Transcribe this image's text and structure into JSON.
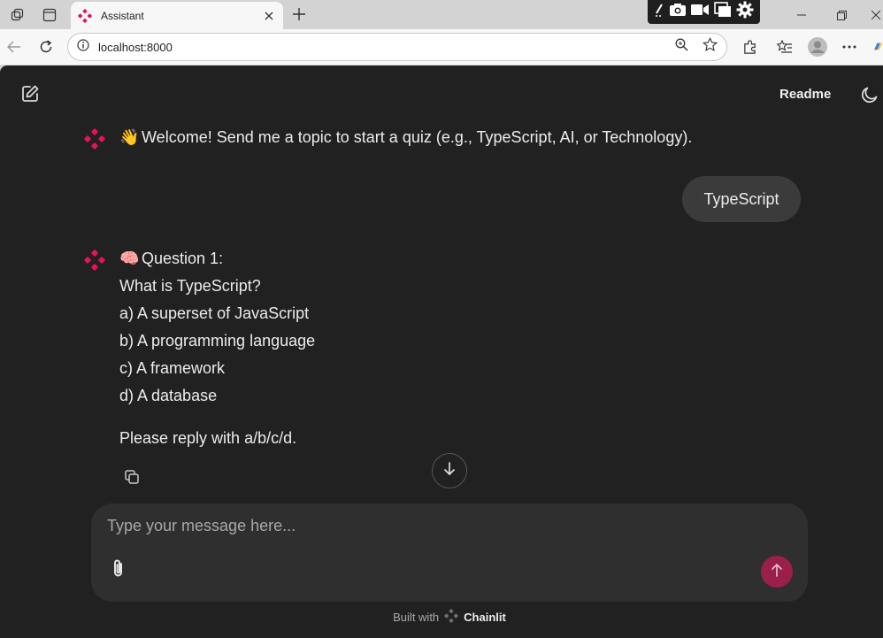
{
  "browser": {
    "tab": {
      "title": "Assistant"
    },
    "address": {
      "url": "localhost:8000"
    }
  },
  "app": {
    "header": {
      "readme_label": "Readme"
    },
    "messages": {
      "welcome": {
        "emoji": "👋",
        "text": "Welcome! Send me a topic to start a quiz (e.g., TypeScript, AI, or Technology)."
      },
      "user": {
        "text": "TypeScript"
      },
      "question": {
        "emoji": "🧠",
        "title": "Question 1:",
        "prompt": "What is TypeScript?",
        "options": [
          "a) A superset of JavaScript",
          "b) A programming language",
          "c) A framework",
          "d) A database"
        ],
        "instruction": "Please reply with a/b/c/d."
      }
    },
    "composer": {
      "placeholder": "Type your message here..."
    },
    "footer": {
      "prefix": "Built with",
      "brand": "Chainlit"
    }
  },
  "colors": {
    "background": "#212121",
    "bubble": "#3b3b3b",
    "composer": "#2f2f2f",
    "brand_pink": "#e6125c",
    "send_button": "#9a1f4a"
  },
  "icons": {
    "new_chat": "edit-square-icon",
    "theme": "moon-icon",
    "copy": "copy-icon",
    "scroll": "arrow-down-icon",
    "attach": "paperclip-icon",
    "send": "arrow-up-icon"
  }
}
